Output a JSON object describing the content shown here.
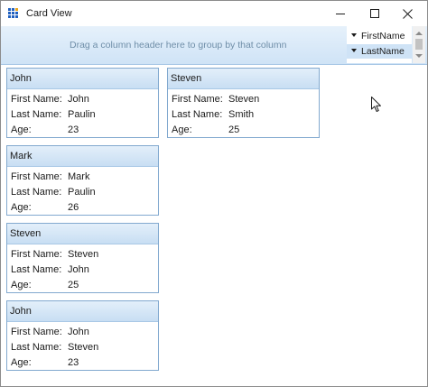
{
  "window": {
    "title": "Card View"
  },
  "group_panel": {
    "hint": "Drag a column header here to group by that column"
  },
  "column_chooser": {
    "items": [
      {
        "label": "FirstName"
      },
      {
        "label": "LastName"
      }
    ]
  },
  "field_labels": {
    "first": "First Name:",
    "last": "Last Name:",
    "age": "Age:"
  },
  "cards": [
    {
      "header": "John",
      "first": "John",
      "last": "Paulin",
      "age": "23"
    },
    {
      "header": "Steven",
      "first": "Steven",
      "last": "Smith",
      "age": "25"
    },
    {
      "header": "Mark",
      "first": "Mark",
      "last": "Paulin",
      "age": "26"
    },
    {
      "header": "Steven",
      "first": "Steven",
      "last": "John",
      "age": "25"
    },
    {
      "header": "John",
      "first": "John",
      "last": "Steven",
      "age": "23"
    }
  ],
  "colors": {
    "accent": "#cfe3f6",
    "border": "#82a9cf",
    "hint": "#6f8ea8"
  },
  "icons": [
    "app-grid-icon",
    "minimize-icon",
    "maximize-icon",
    "close-icon",
    "sort-arrow-icon",
    "mouse-cursor-icon"
  ]
}
